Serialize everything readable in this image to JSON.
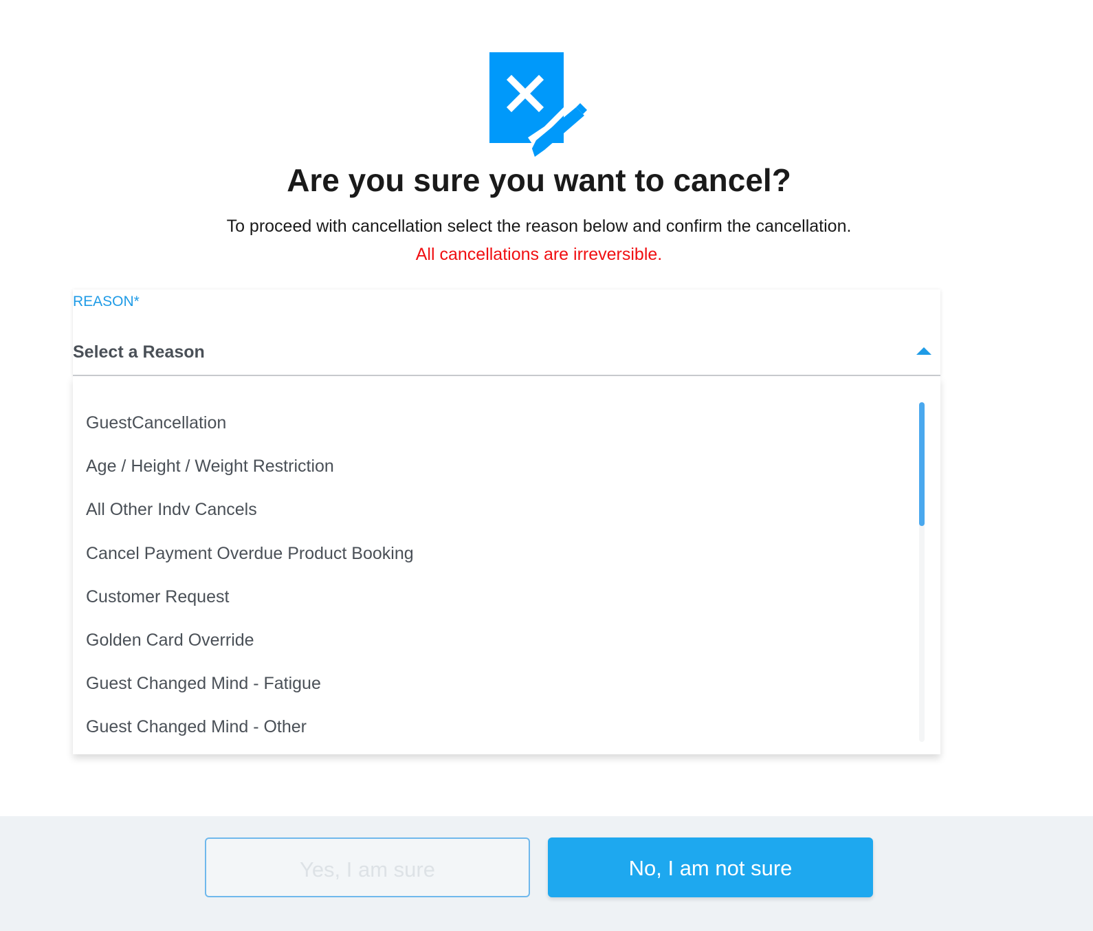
{
  "dialog": {
    "icon": "cancel-document-pencil-icon",
    "title": "Are you sure you want to cancel?",
    "subtitle": "To proceed with cancellation select the reason below and confirm the cancellation.",
    "warning": "All cancellations are irreversible."
  },
  "reason_select": {
    "label": "REASON*",
    "value": "Select a Reason",
    "expanded": true,
    "options": [
      "GuestCancellation",
      "Age / Height / Weight Restriction",
      "All Other Indv Cancels",
      "Cancel Payment Overdue Product Booking",
      "Customer Request",
      "Golden Card Override",
      "Guest Changed Mind - Fatigue",
      "Guest Changed Mind - Other"
    ]
  },
  "buttons": {
    "confirm_label": "Yes, I am sure",
    "confirm_disabled": true,
    "decline_label": "No, I am not sure"
  },
  "colors": {
    "accent": "#1ea8ef",
    "label_blue": "#1f9be6",
    "warning_red": "#f00f12",
    "footer_bg": "#eef2f5"
  }
}
